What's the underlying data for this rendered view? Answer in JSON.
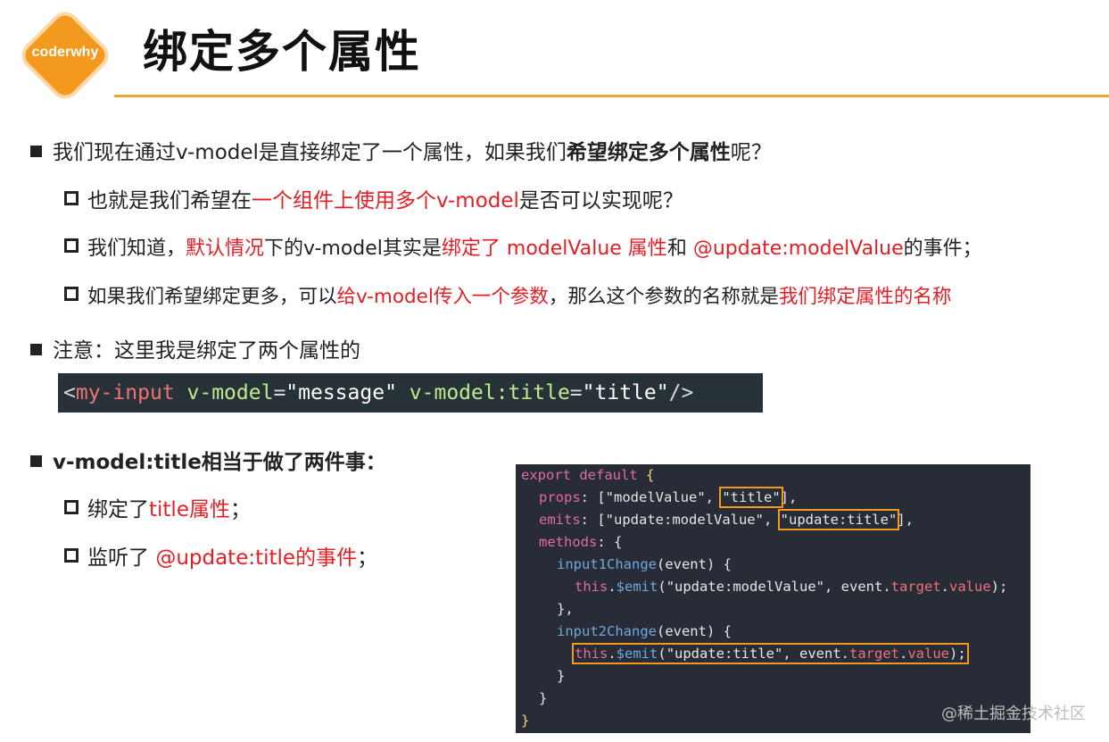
{
  "logo": {
    "text": "coderwhy"
  },
  "title": "绑定多个属性",
  "bullets": {
    "b1": {
      "t1": "我们现在通过v-model是直接绑定了一个属性，如果我们",
      "t2": "希望绑定多个属性",
      "t3": "呢？"
    },
    "b1_1": {
      "t1": "也就是我们希望在",
      "t2": "一个组件上使用多个v-model",
      "t3": "是否可以实现呢？"
    },
    "b1_2": {
      "t1": "我们知道，",
      "t2": "默认情况",
      "t3": "下的v-model其实是",
      "t4": "绑定了 modelValue 属性",
      "t5": "和 ",
      "t6": "@update:modelValue",
      "t7": "的事件；"
    },
    "b1_3": {
      "t1": "如果我们希望绑定更多，可以",
      "t2": "给v-model传入一个参数",
      "t3": "，那么这个参数的名称就是",
      "t4": "我们绑定属性的名称"
    },
    "b2": {
      "t1": "注意：这里我是绑定了两个属性的"
    },
    "b3": {
      "t1": "v-model:title相当于做了两件事："
    },
    "b3_1": {
      "t1": "绑定了",
      "t2": "title属性",
      "t3": "；"
    },
    "b3_2": {
      "t1": "监听了 ",
      "t2": "@update:title的事件",
      "t3": "；"
    }
  },
  "code_line": {
    "open": "<",
    "tag": "my-input",
    "attr1": "v-model",
    "eq1": "=",
    "val1": "\"message\"",
    "attr2": "v-model:title",
    "eq2": "=",
    "val2": "\"title\"",
    "close": "/>"
  },
  "code_block": {
    "l1_a": "export",
    "l1_b": "default",
    "l1_c": "{",
    "l2_a": "props",
    "l2_b": ": [",
    "l2_c": "\"modelValue\"",
    "l2_d": ", ",
    "l2_e": "\"title\"",
    "l2_f": "],",
    "l3_a": "emits",
    "l3_b": ": [",
    "l3_c": "\"update:modelValue\"",
    "l3_d": ", ",
    "l3_e": "\"update:title\"",
    "l3_f": "],",
    "l4_a": "methods",
    "l4_b": ": {",
    "l5_a": "input1Change",
    "l5_b": "(event) {",
    "l6_a": "this",
    "l6_b": ".",
    "l6_c": "$emit",
    "l6_d": "(",
    "l6_e": "\"update:modelValue\"",
    "l6_f": ", event.",
    "l6_g": "target",
    "l6_h": ".",
    "l6_i": "value",
    "l6_j": ");",
    "l7_a": "},",
    "l8_a": "input2Change",
    "l8_b": "(event) {",
    "l9_a": "this",
    "l9_b": ".",
    "l9_c": "$emit",
    "l9_d": "(",
    "l9_e": "\"update:title\"",
    "l9_f": ", event.",
    "l9_g": "target",
    "l9_h": ".",
    "l9_i": "value",
    "l9_j": ");",
    "l10_a": "}",
    "l11_a": "}",
    "l12_a": "}"
  },
  "watermark": "@稀土掘金技术社区",
  "colors": {
    "accent": "#F39A1E",
    "red": "#E31E24",
    "code_bg": "#263238",
    "block_bg": "#272C36"
  }
}
